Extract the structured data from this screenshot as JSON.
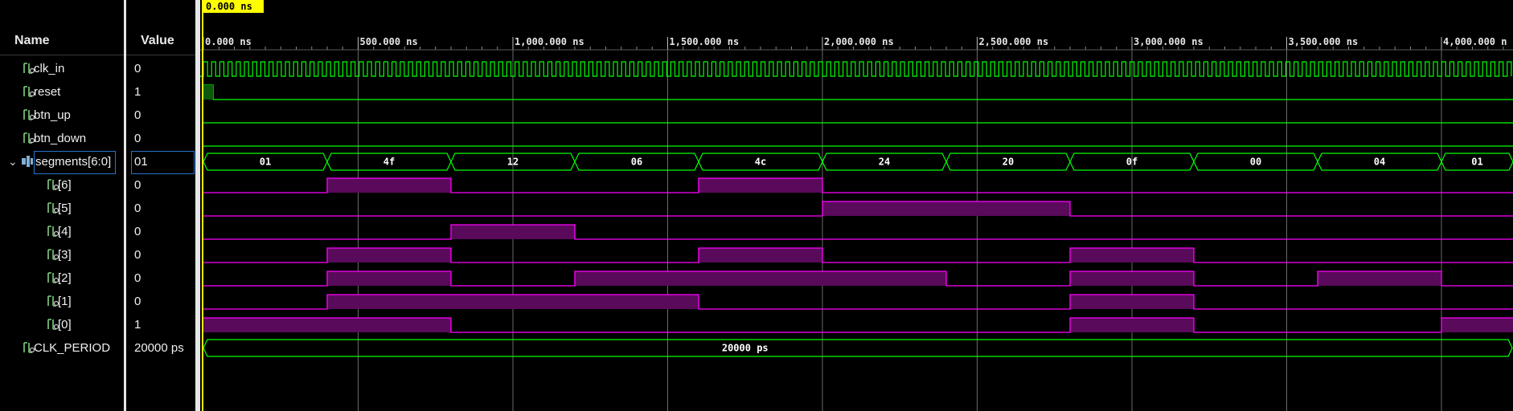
{
  "columns": {
    "name": "Name",
    "value": "Value"
  },
  "cursor": {
    "label": "0.000 ns"
  },
  "timeline": {
    "ticks": [
      "0.000 ns",
      "500.000 ns",
      "1,000.000 ns",
      "1,500.000 ns",
      "2,000.000 ns",
      "2,500.000 ns",
      "3,000.000 ns",
      "3,500.000 ns",
      "4,000.000 n"
    ]
  },
  "signals": [
    {
      "name": "clk_in",
      "value": "0"
    },
    {
      "name": "reset",
      "value": "1"
    },
    {
      "name": "btn_up",
      "value": "0"
    },
    {
      "name": "btn_down",
      "value": "0"
    },
    {
      "name": "segments[6:0]",
      "value": "01"
    },
    {
      "name": "[6]",
      "value": "0"
    },
    {
      "name": "[5]",
      "value": "0"
    },
    {
      "name": "[4]",
      "value": "0"
    },
    {
      "name": "[3]",
      "value": "0"
    },
    {
      "name": "[2]",
      "value": "0"
    },
    {
      "name": "[1]",
      "value": "0"
    },
    {
      "name": "[0]",
      "value": "1"
    },
    {
      "name": "CLK_PERIOD",
      "value": "20000 ps"
    }
  ],
  "bus_values": [
    "01",
    "4f",
    "12",
    "06",
    "4c",
    "24",
    "20",
    "0f",
    "00",
    "04",
    "01"
  ],
  "clk_period_value": "20000 ps",
  "colors": {
    "green": "#00ff00",
    "magenta": "#ff00ff",
    "bus_fill": "#5a0a5a",
    "cursor": "#ffff00",
    "grid": "#6a6a6a"
  }
}
